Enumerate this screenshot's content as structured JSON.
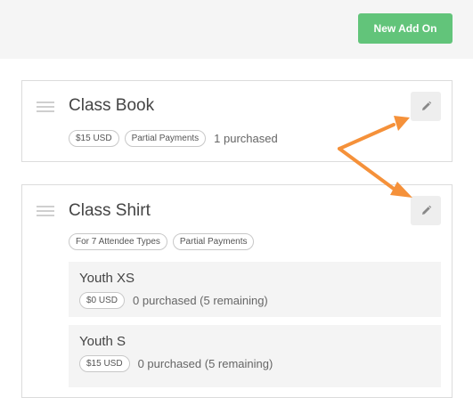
{
  "toolbar": {
    "new_add_on_label": "New Add On"
  },
  "add_ons": [
    {
      "title": "Class Book",
      "pills": [
        "$15 USD",
        "Partial Payments"
      ],
      "purchased": "1 purchased"
    },
    {
      "title": "Class Shirt",
      "pills": [
        "For 7 Attendee Types",
        "Partial Payments"
      ],
      "variants": [
        {
          "name": "Youth XS",
          "price": "$0 USD",
          "status": "0 purchased (5 remaining)"
        },
        {
          "name": "Youth S",
          "price": "$15 USD",
          "status": "0 purchased (5 remaining)"
        }
      ]
    }
  ],
  "colors": {
    "accent_button": "#62c47a",
    "annotation_arrow": "#f5913a"
  },
  "icons": {
    "drag": "drag-handle-icon",
    "edit": "pencil-icon"
  }
}
